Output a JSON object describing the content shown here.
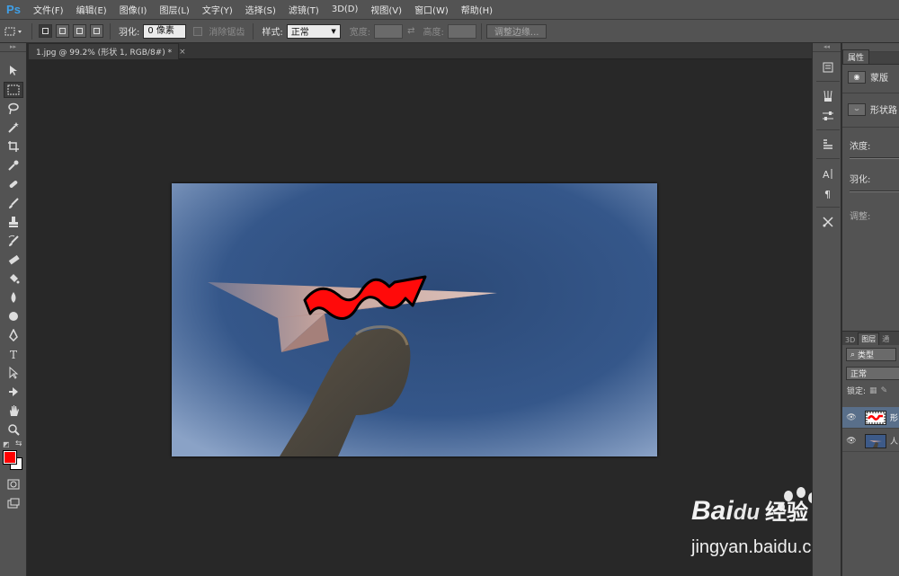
{
  "app": {
    "logo": "Ps"
  },
  "menu": [
    "文件(F)",
    "编辑(E)",
    "图像(I)",
    "图层(L)",
    "文字(Y)",
    "选择(S)",
    "滤镜(T)",
    "3D(D)",
    "视图(V)",
    "窗口(W)",
    "帮助(H)"
  ],
  "options": {
    "feather_label": "羽化:",
    "feather_value": "0 像素",
    "antialias_label": "消除锯齿",
    "style_label": "样式:",
    "style_value": "正常",
    "width_label": "宽度:",
    "height_label": "高度:",
    "refine_edge_label": "调整边缘..."
  },
  "document": {
    "tab_title": "1.jpg @ 99.2% (形状 1, RGB/8#) *",
    "close": "×"
  },
  "colors": {
    "foreground": "#ff0000",
    "background": "#ffffff"
  },
  "properties": {
    "tab": "属性",
    "mask_label": "蒙版",
    "shape_path_label": "形状路",
    "density_label": "浓度:",
    "feather_label": "羽化:",
    "adjust_label": "调整:"
  },
  "layers": {
    "tabs": [
      "3D",
      "图层",
      "通"
    ],
    "filter_value": "类型",
    "blend_value": "正常",
    "lock_label": "锁定:",
    "rows": [
      {
        "name": "形",
        "selected": true
      },
      {
        "name": "人",
        "selected": false
      }
    ]
  },
  "watermark": {
    "brand": "Bai",
    "brand_du": "du",
    "suffix": "经验",
    "url": "jingyan.baidu.com"
  }
}
